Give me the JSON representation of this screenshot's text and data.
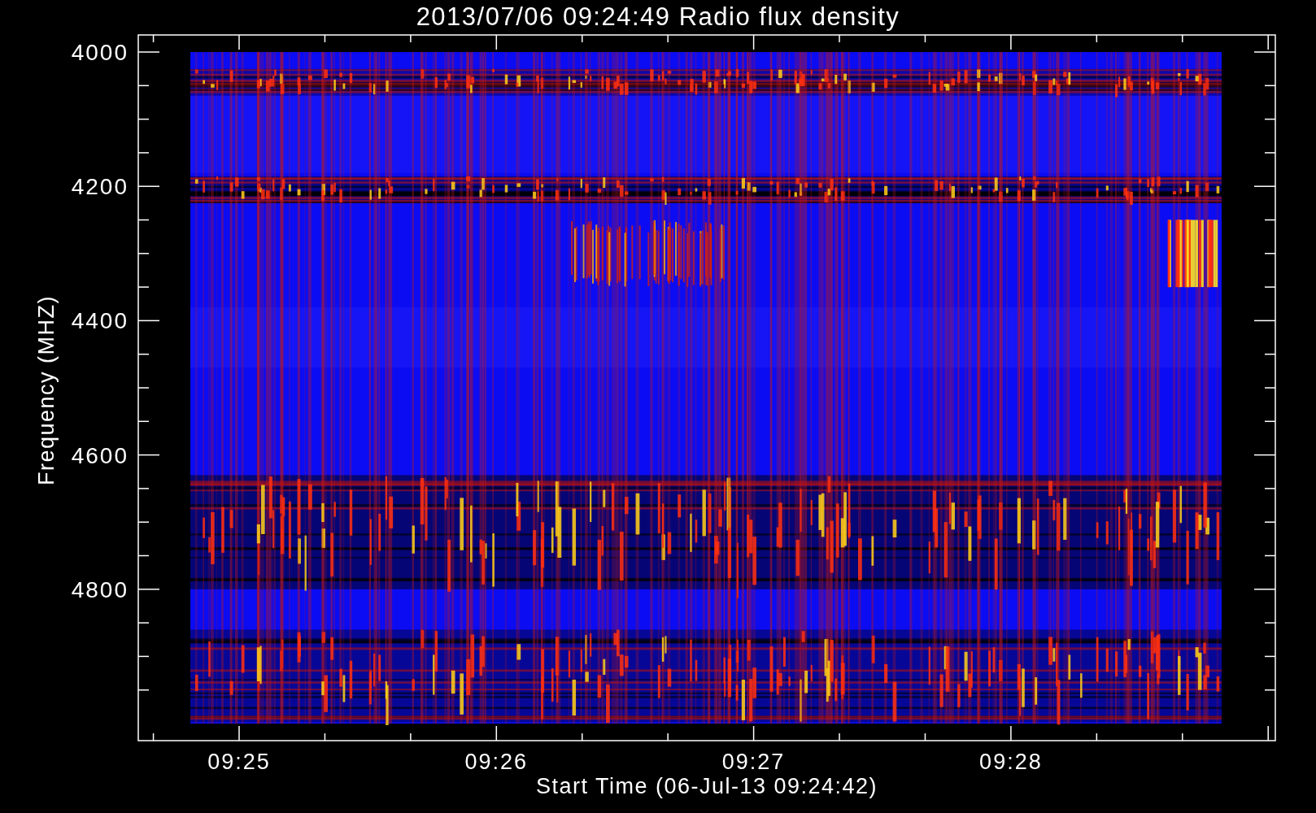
{
  "title": "2013/07/06 09:24:49 Radio flux density",
  "y_axis": {
    "label": "Frequency (MHZ)",
    "ticks": [
      "4000",
      "4200",
      "4400",
      "4600",
      "4800"
    ]
  },
  "x_axis": {
    "label": "Start Time (06-Jul-13 09:24:42)",
    "ticks": [
      "09:25",
      "09:26",
      "09:27",
      "09:28"
    ]
  }
}
